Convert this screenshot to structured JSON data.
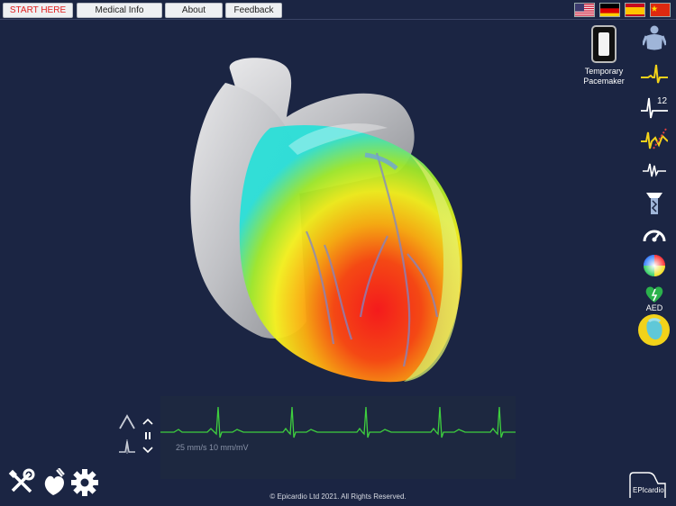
{
  "nav": {
    "start": "START HERE",
    "medical": "Medical Info",
    "about": "About",
    "feedback": "Feedback"
  },
  "languages": [
    "English (US)",
    "German",
    "Spanish",
    "Chinese"
  ],
  "pacemaker": {
    "label_line1": "Temporary",
    "label_line2": "Pacemaker"
  },
  "tools": {
    "items": [
      "body-view-icon",
      "ecg-trace-icon",
      "12-lead-icon",
      "arrhythmia-icon",
      "heartbeat-icon",
      "catheter-icon",
      "speed-gauge-icon",
      "color-wheel-icon",
      "aed-icon",
      "heart-map-icon"
    ],
    "lead_count": "12",
    "aed_label": "AED"
  },
  "ecg": {
    "caption": "25 mm/s  10 mm/mV",
    "trace_color": "#3ecf3e"
  },
  "footer": {
    "copyright": "© Epicardio Ltd 2021. All Rights Reserved.",
    "logo_text": "EPIcardio"
  },
  "colors": {
    "background": "#1b2543",
    "start_text": "#e02020",
    "highlight": "#f2d21a"
  }
}
